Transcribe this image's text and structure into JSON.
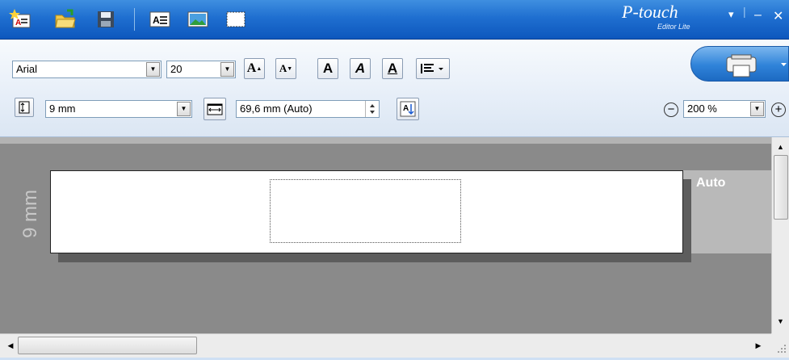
{
  "app": {
    "brand_logo": "P-touch",
    "brand_sub": "Editor Lite",
    "window_controls": {
      "minimize": "–",
      "close": "✕",
      "menu": "▾"
    }
  },
  "titlebar": {
    "icons": [
      "new-label-icon",
      "open-folder-icon",
      "save-icon",
      "insert-text-icon",
      "insert-image-icon",
      "insert-frame-icon"
    ]
  },
  "format": {
    "font_name": "Arial",
    "font_size": "20",
    "grow_font": "A",
    "shrink_font": "A",
    "bold": "A",
    "italic": "A",
    "underline": "A"
  },
  "tape": {
    "width_value": "9 mm",
    "length_value": "69,6 mm (Auto)",
    "zoom_value": "200 %"
  },
  "canvas": {
    "height_label": "9 mm",
    "auto_label": "Auto"
  },
  "colors": {
    "title_blue": "#1f6fd0",
    "canvas_gray": "#8a8a8a",
    "print_button_blue": "#2f83d9"
  }
}
